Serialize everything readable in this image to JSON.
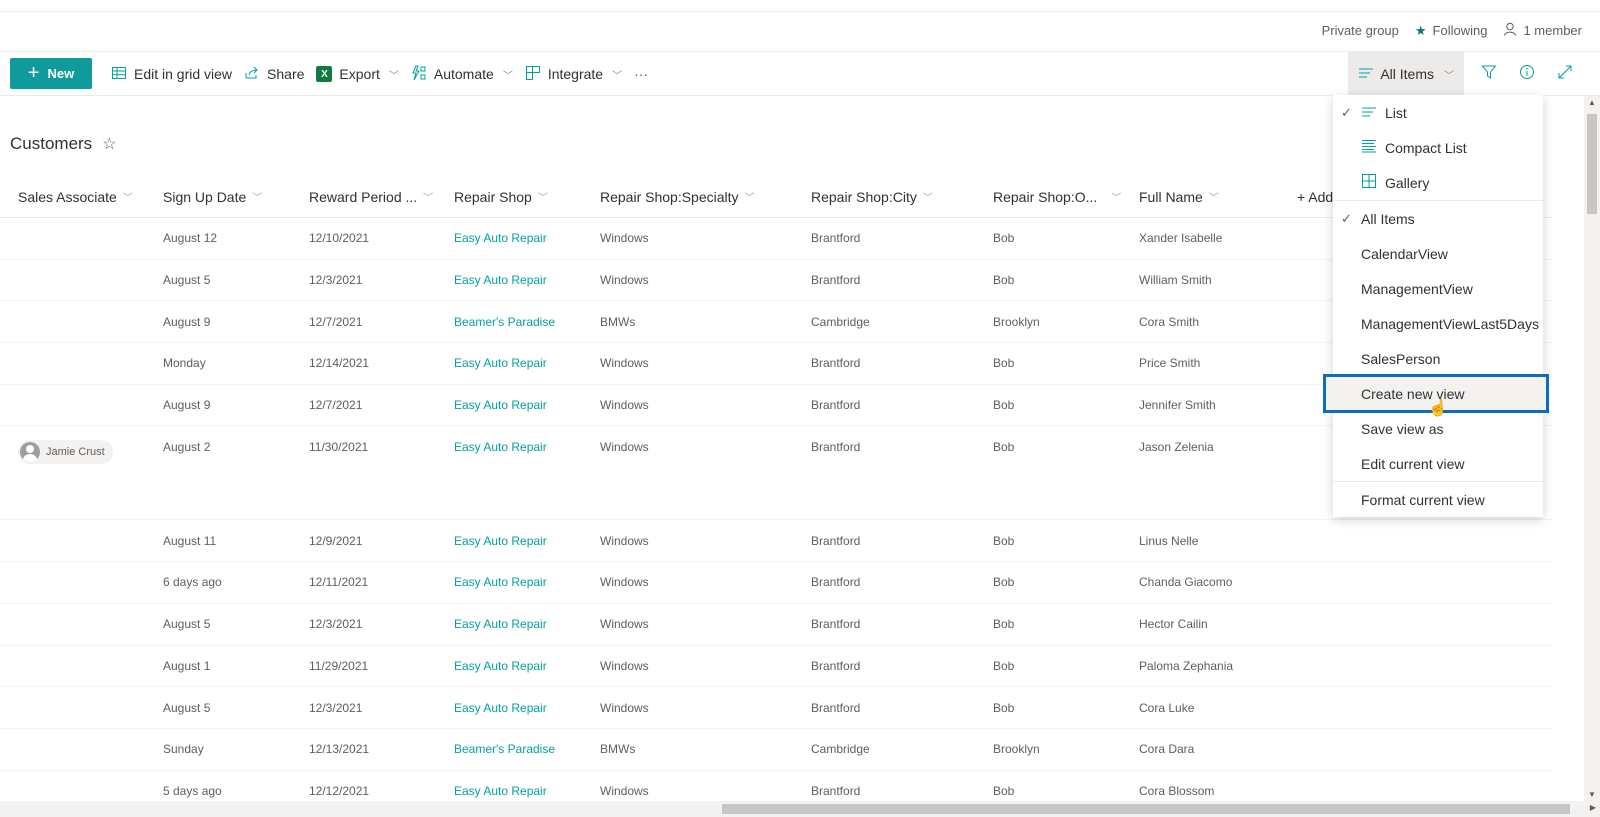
{
  "group": {
    "privacy": "Private group",
    "following": "Following",
    "members": "1 member"
  },
  "toolbar": {
    "new_label": "New",
    "edit_grid": "Edit in grid view",
    "share": "Share",
    "export": "Export",
    "automate": "Automate",
    "integrate": "Integrate",
    "more": "···",
    "view_label": "All Items"
  },
  "list": {
    "title": "Customers"
  },
  "columns": [
    "Sales Associate",
    "Sign Up Date",
    "Reward Period ...",
    "Repair Shop",
    "Repair Shop:Specialty",
    "Repair Shop:City",
    "Repair Shop:O...",
    "Full Name",
    "+ Add c"
  ],
  "rows": [
    {
      "associate": "",
      "signup": "August 12",
      "reward": "12/10/2021",
      "shop": "Easy Auto Repair",
      "specialty": "Windows",
      "city": "Brantford",
      "owner": "Bob",
      "name": "Xander Isabelle"
    },
    {
      "associate": "",
      "signup": "August 5",
      "reward": "12/3/2021",
      "shop": "Easy Auto Repair",
      "specialty": "Windows",
      "city": "Brantford",
      "owner": "Bob",
      "name": "William Smith"
    },
    {
      "associate": "",
      "signup": "August 9",
      "reward": "12/7/2021",
      "shop": "Beamer's Paradise",
      "specialty": "BMWs",
      "city": "Cambridge",
      "owner": "Brooklyn",
      "name": "Cora Smith"
    },
    {
      "associate": "",
      "signup": "Monday",
      "reward": "12/14/2021",
      "shop": "Easy Auto Repair",
      "specialty": "Windows",
      "city": "Brantford",
      "owner": "Bob",
      "name": "Price Smith"
    },
    {
      "associate": "",
      "signup": "August 9",
      "reward": "12/7/2021",
      "shop": "Easy Auto Repair",
      "specialty": "Windows",
      "city": "Brantford",
      "owner": "Bob",
      "name": "Jennifer Smith"
    },
    {
      "associate": "Jamie Crust",
      "signup": "August 2",
      "reward": "11/30/2021",
      "shop": "Easy Auto Repair",
      "specialty": "Windows",
      "city": "Brantford",
      "owner": "Bob",
      "name": "Jason Zelenia"
    },
    {
      "associate": "",
      "signup": "August 11",
      "reward": "12/9/2021",
      "shop": "Easy Auto Repair",
      "specialty": "Windows",
      "city": "Brantford",
      "owner": "Bob",
      "name": "Linus Nelle"
    },
    {
      "associate": "",
      "signup": "6 days ago",
      "reward": "12/11/2021",
      "shop": "Easy Auto Repair",
      "specialty": "Windows",
      "city": "Brantford",
      "owner": "Bob",
      "name": "Chanda Giacomo"
    },
    {
      "associate": "",
      "signup": "August 5",
      "reward": "12/3/2021",
      "shop": "Easy Auto Repair",
      "specialty": "Windows",
      "city": "Brantford",
      "owner": "Bob",
      "name": "Hector Cailin"
    },
    {
      "associate": "",
      "signup": "August 1",
      "reward": "11/29/2021",
      "shop": "Easy Auto Repair",
      "specialty": "Windows",
      "city": "Brantford",
      "owner": "Bob",
      "name": "Paloma Zephania"
    },
    {
      "associate": "",
      "signup": "August 5",
      "reward": "12/3/2021",
      "shop": "Easy Auto Repair",
      "specialty": "Windows",
      "city": "Brantford",
      "owner": "Bob",
      "name": "Cora Luke"
    },
    {
      "associate": "",
      "signup": "Sunday",
      "reward": "12/13/2021",
      "shop": "Beamer's Paradise",
      "specialty": "BMWs",
      "city": "Cambridge",
      "owner": "Brooklyn",
      "name": "Cora Dara"
    },
    {
      "associate": "",
      "signup": "5 days ago",
      "reward": "12/12/2021",
      "shop": "Easy Auto Repair",
      "specialty": "Windows",
      "city": "Brantford",
      "owner": "Bob",
      "name": "Cora Blossom"
    }
  ],
  "view_menu": {
    "layouts": [
      {
        "label": "List",
        "icon": "list-icon",
        "checked": true
      },
      {
        "label": "Compact List",
        "icon": "compact-list-icon",
        "checked": false
      },
      {
        "label": "Gallery",
        "icon": "gallery-icon",
        "checked": false
      }
    ],
    "views": [
      {
        "label": "All Items",
        "checked": true
      },
      {
        "label": "CalendarView",
        "checked": false
      },
      {
        "label": "ManagementView",
        "checked": false
      },
      {
        "label": "ManagementViewLast5Days",
        "checked": false
      },
      {
        "label": "SalesPerson",
        "checked": false
      }
    ],
    "actions": [
      {
        "label": "Create new view",
        "highlighted": true
      },
      {
        "label": "Save view as",
        "highlighted": false
      },
      {
        "label": "Edit current view",
        "highlighted": false
      }
    ],
    "footer": "Format current view"
  },
  "colors": {
    "accent": "#03a0a0",
    "highlight_border": "#0f6cbd"
  }
}
